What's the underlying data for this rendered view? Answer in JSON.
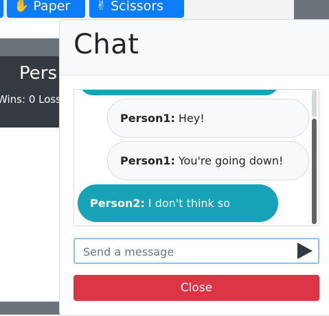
{
  "toolbar": {
    "paper_label": "Paper",
    "scissors_label": "Scissors"
  },
  "player_card": {
    "name": "Pers",
    "stats": "Wins: 0 Loss"
  },
  "chat": {
    "title": "Chat",
    "messages": [
      {
        "sender": "",
        "text": ""
      },
      {
        "sender": "Person1:",
        "text": "Hey!"
      },
      {
        "sender": "Person1:",
        "text": "You're going down!"
      },
      {
        "sender": "Person2:",
        "text": "I don't think so"
      }
    ],
    "input_placeholder": "Send a message",
    "close_label": "Close"
  },
  "colors": {
    "primary": "#0d7cf8",
    "teal": "#17a2b8",
    "danger": "#dc3545",
    "dark": "#343a40"
  },
  "icons": {
    "paper": "hand-paper-icon",
    "scissors": "hand-scissors-icon",
    "send": "send-triangle-icon"
  }
}
